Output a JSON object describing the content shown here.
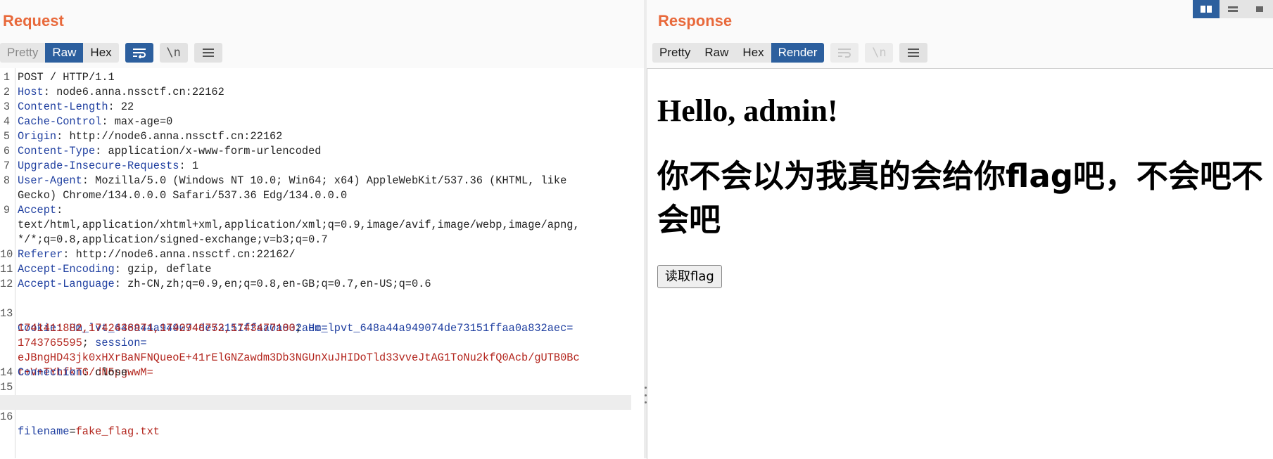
{
  "request": {
    "title": "Request",
    "tabs": [
      {
        "label": "Pretty",
        "state": "disabled"
      },
      {
        "label": "Raw",
        "state": "active"
      },
      {
        "label": "Hex",
        "state": "normal"
      }
    ],
    "icons": [
      "word-wrap-icon",
      "newline-icon",
      "menu-icon"
    ],
    "newline_glyph": "\\n",
    "lines": [
      {
        "n": "1",
        "key": "",
        "value": "POST / HTTP/1.1"
      },
      {
        "n": "2",
        "key": "Host",
        "value": "node6.anna.nssctf.cn:22162"
      },
      {
        "n": "3",
        "key": "Content-Length",
        "value": "22"
      },
      {
        "n": "4",
        "key": "Cache-Control",
        "value": "max-age=0"
      },
      {
        "n": "5",
        "key": "Origin",
        "value": "http://node6.anna.nssctf.cn:22162"
      },
      {
        "n": "6",
        "key": "Content-Type",
        "value": "application/x-www-form-urlencoded"
      },
      {
        "n": "7",
        "key": "Upgrade-Insecure-Requests",
        "value": "1"
      },
      {
        "n": "8",
        "key": "User-Agent",
        "value": "Mozilla/5.0 (Windows NT 10.0; Win64; x64) AppleWebKit/537.36 (KHTML, like"
      },
      {
        "n": "",
        "key": "",
        "value": "Gecko) Chrome/134.0.0.0 Safari/537.36 Edg/134.0.0.0"
      },
      {
        "n": "9",
        "key": "Accept",
        "value": ""
      },
      {
        "n": "",
        "key": "",
        "value": "text/html,application/xhtml+xml,application/xml;q=0.9,image/avif,image/webp,image/apng,"
      },
      {
        "n": "",
        "key": "",
        "value": "*/*;q=0.8,application/signed-exchange;v=b3;q=0.7"
      },
      {
        "n": "10",
        "key": "Referer",
        "value": "http://node6.anna.nssctf.cn:22162/"
      },
      {
        "n": "11",
        "key": "Accept-Encoding",
        "value": "gzip, deflate"
      },
      {
        "n": "12",
        "key": "Accept-Language",
        "value": "zh-CN,zh;q=0.9,en;q=0.8,en-GB;q=0.7,en-US;q=0.6"
      }
    ],
    "cookie": {
      "n": "13",
      "key": "Cookie",
      "c1_key": "Hm_lvt_648a44a949074de73151ffaa0a832aec",
      "c1_value": "1741411882,1742436971,1742948752,1743477100",
      "c2_key": "Hm_lpvt_648a44a949074de73151ffaa0a832aec",
      "c2_value": "1743765595",
      "c3_key": "session",
      "c3_value_line1": "eJBngHD43jk0xHXrBaNFNQueoE+41rElGNZawdm3Db3NGUnXuJHIDoTld33vveJtAG1ToNu2kfQ0Acb/gUTB0Bc",
      "c3_value_line2": "t+V+TYhfkTG/dN5pgwwM="
    },
    "tail_lines": [
      {
        "n": "14",
        "key": "Connection",
        "value": "close"
      },
      {
        "n": "15",
        "key": "",
        "value": ""
      }
    ],
    "body_line": {
      "n": "16",
      "key": "filename",
      "value": "fake_flag.txt"
    }
  },
  "response": {
    "title": "Response",
    "tabs": [
      {
        "label": "Pretty",
        "state": "normal"
      },
      {
        "label": "Raw",
        "state": "normal"
      },
      {
        "label": "Hex",
        "state": "normal"
      },
      {
        "label": "Render",
        "state": "active"
      }
    ],
    "render": {
      "heading": "Hello, admin!",
      "subheading": "你不会以为我真的会给你flag吧，不会吧不会吧",
      "button": "读取flag"
    }
  },
  "layout_switch": [
    "side-by-side-icon",
    "stacked-icon",
    "single-panel-icon"
  ],
  "colors": {
    "accent": "#e8693b",
    "active_tab": "#2c5f9e",
    "header_key": "#1f3fa0",
    "cookie_value": "#b3261e"
  }
}
